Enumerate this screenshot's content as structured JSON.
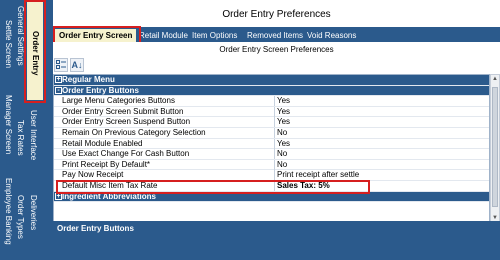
{
  "header": {
    "title": "Order Entry Preferences"
  },
  "side_tabs": [
    {
      "label": "Order Entry",
      "active": true
    },
    {
      "label": "General Settings"
    },
    {
      "label": "Settle Screen"
    },
    {
      "label": "User Interface"
    },
    {
      "label": "Tax Rates"
    },
    {
      "label": "Manager Screen"
    },
    {
      "label": "Deliveries"
    },
    {
      "label": "Order Types"
    },
    {
      "label": "Employee Banking"
    }
  ],
  "tabs": [
    {
      "label": "Order Entry Screen",
      "active": true
    },
    {
      "label": "Retail Module"
    },
    {
      "label": "Item Options"
    },
    {
      "label": "Removed Items"
    },
    {
      "label": "Void Reasons"
    }
  ],
  "panel": {
    "subtitle": "Order Entry Screen Preferences",
    "toolbar": {
      "categorized_icon": "categorized-view-icon",
      "sort_icon": "alphabetical-sort-icon",
      "sort_glyph": "A↓"
    }
  },
  "grid": {
    "categories": [
      {
        "label": "Regular Menu",
        "expander": "+"
      },
      {
        "label": "Order Entry Buttons",
        "expander": "-"
      },
      {
        "label": "Ingredient Abbreviations",
        "expander": "+"
      }
    ],
    "rows": [
      {
        "name": "Large Menu Categories Buttons",
        "value": "Yes"
      },
      {
        "name": "Order Entry Screen Submit Button",
        "value": "Yes"
      },
      {
        "name": "Order Entry Screen Suspend Button",
        "value": "Yes"
      },
      {
        "name": "Remain On Previous Category Selection",
        "value": "No"
      },
      {
        "name": "Retail Module Enabled",
        "value": "Yes"
      },
      {
        "name": "Use Exact Change For Cash Button",
        "value": "No"
      },
      {
        "name": "Print Receipt By Default*",
        "value": "No"
      },
      {
        "name": "Pay Now Receipt",
        "value": "Print receipt after settle"
      },
      {
        "name": "Default Misc Item Tax Rate",
        "value": "Sales Tax:  5%"
      }
    ]
  },
  "description": {
    "title": "Order Entry Buttons"
  },
  "colors": {
    "accent": "#2b5a8c",
    "active_tab": "#f6f2ce",
    "highlight": "#d61f1f"
  }
}
